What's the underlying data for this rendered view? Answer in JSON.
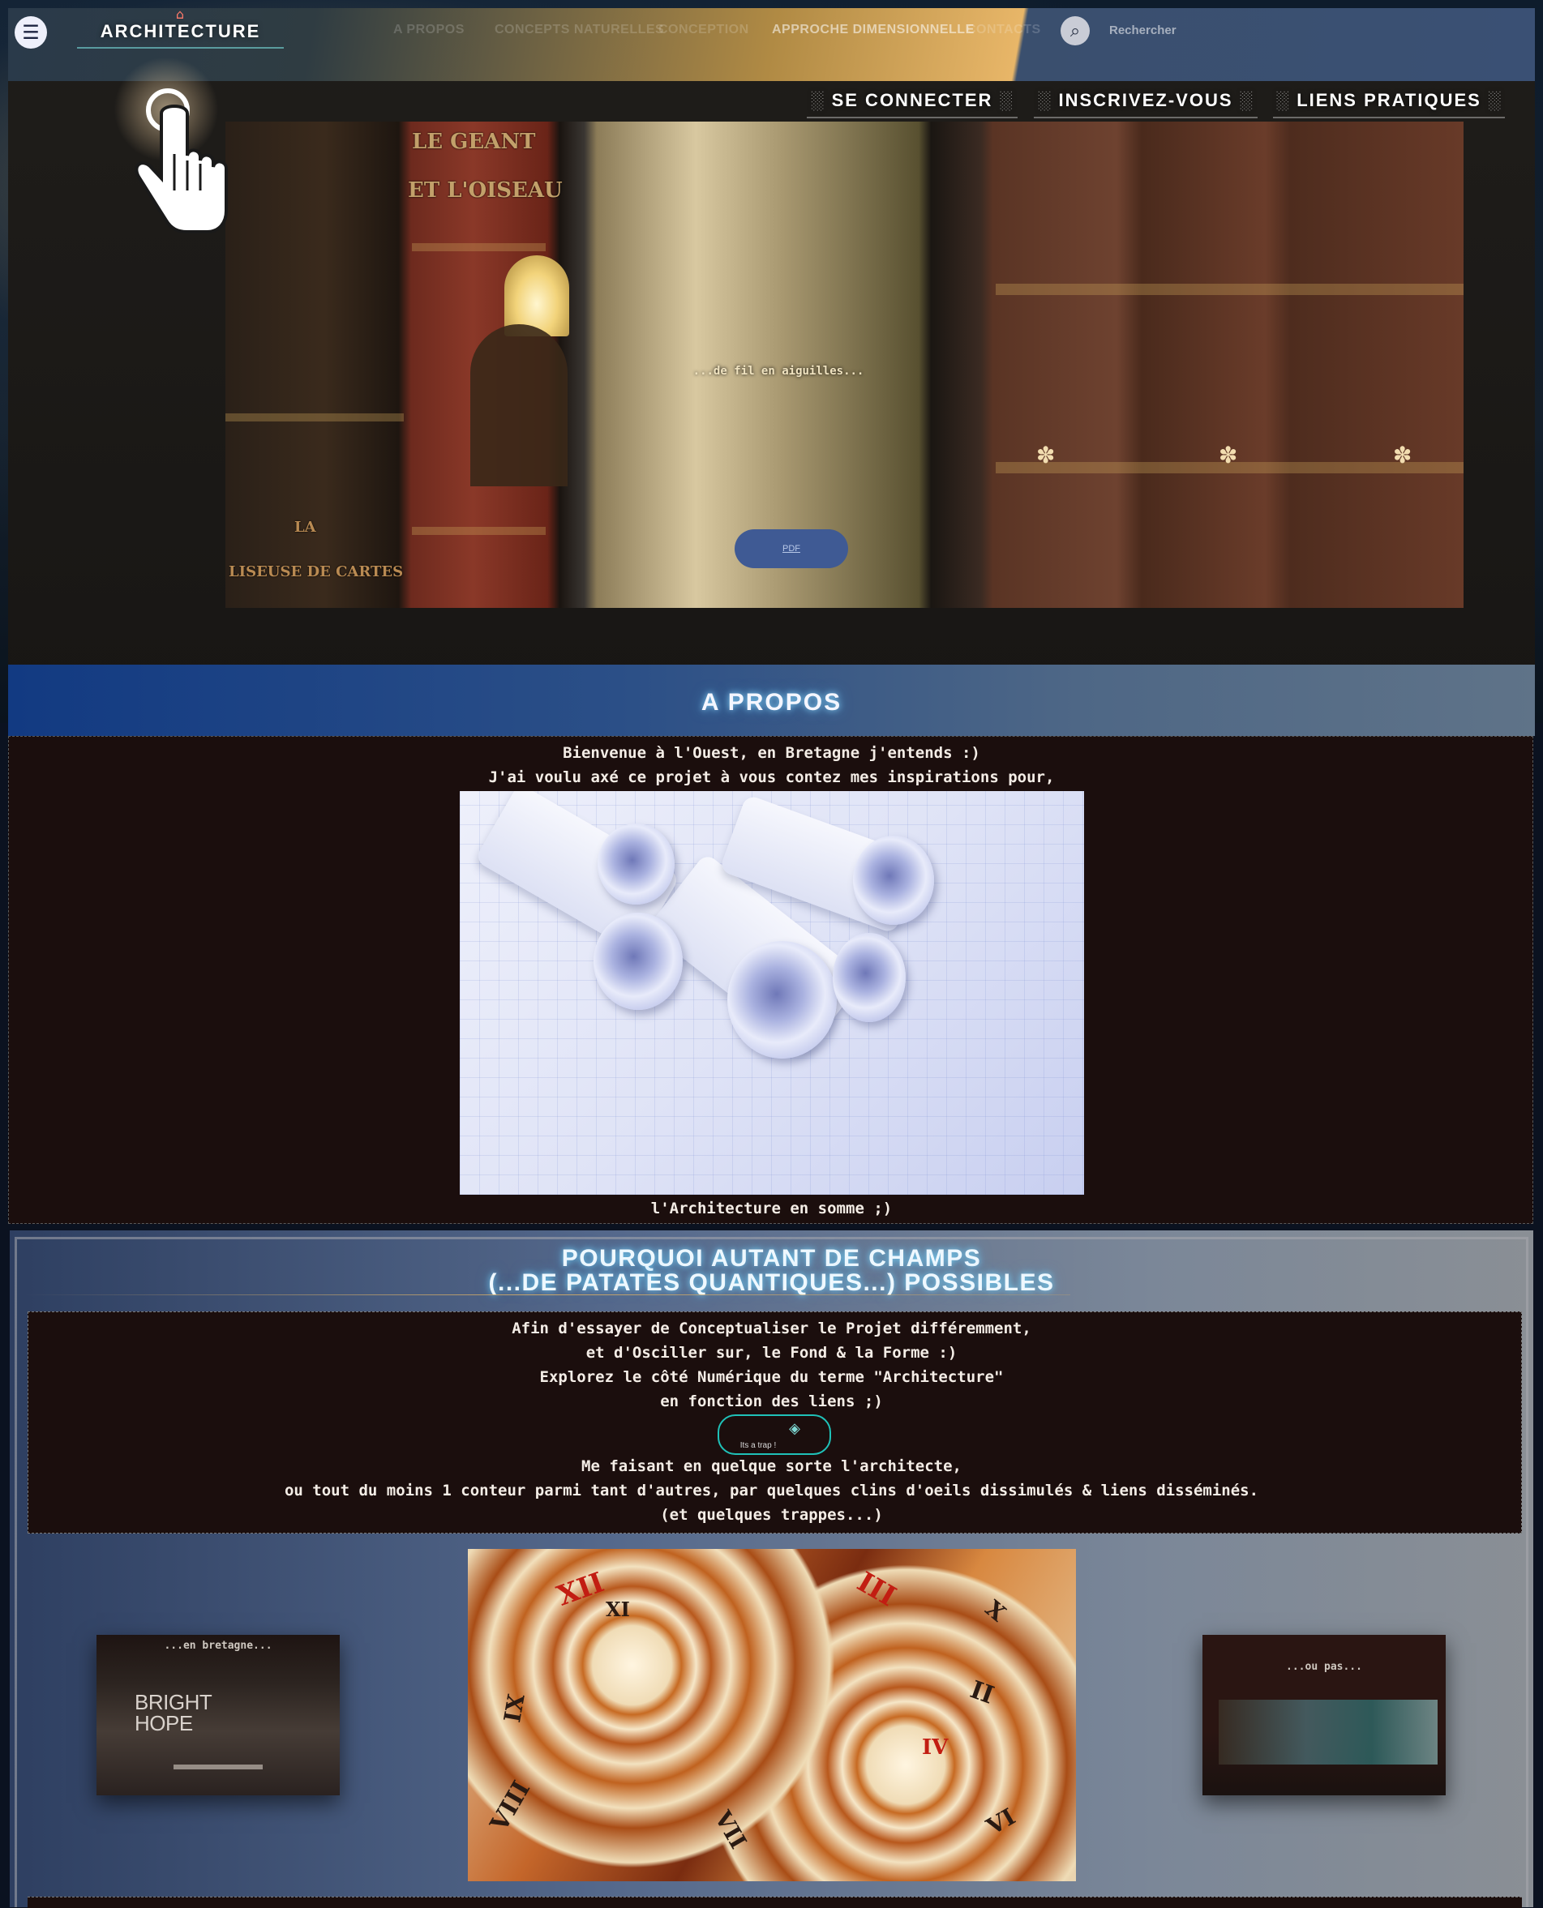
{
  "topbar": {
    "brand": "ARCHITECTURE",
    "nav": [
      "A PROPOS",
      "CONCEPTS NATURELLES",
      "CONCEPTION",
      "APPROCHE DIMENSIONNELLE",
      "CONTACTS"
    ],
    "search_label": "Rechercher"
  },
  "actions": {
    "login": "SE CONNECTER",
    "register": "INSCRIVEZ-VOUS",
    "links": "LIENS PRATIQUES",
    "hatch": "░"
  },
  "hero": {
    "caption": "...de fil en aiguilles...",
    "pdf_label": "PDF",
    "book_titles": [
      "LE GEANT",
      "ET L'OISEAU",
      "LA",
      "LISEUSE DE CARTES"
    ]
  },
  "apropos": {
    "title": "A PROPOS",
    "line1": "Bienvenue à l'Ouest, en Bretagne j'entends :)",
    "line2": "J'ai voulu axé ce projet à vous contez mes inspirations pour,",
    "caption": "l'Architecture en somme ;)"
  },
  "section2": {
    "title_line1": "POURQUOI AUTANT DE CHAMPS",
    "title_line2": "(...DE PATATES QUANTIQUES...) POSSIBLES",
    "lines_top": [
      "Afin d'essayer de Conceptualiser le Projet différemment,",
      "et d'Osciller sur, le Fond & la Forme :)",
      "Explorez le côté Numérique du terme \"Architecture\"",
      "en fonction des liens ;)"
    ],
    "trap_label": "Its a trap !",
    "lines_bottom": [
      "Me faisant en quelque sorte l'architecte,",
      "ou tout du moins 1 conteur parmi tant d'autres, par quelques clins d'oeils dissimulés & liens disséminés.",
      "(et quelques trappes...)"
    ]
  },
  "gallery": {
    "left_caption": "...en bretagne...",
    "left_text": "BRIGHT HOPE",
    "right_caption": "...ou pas...",
    "clock_numerals": [
      "XII",
      "XI",
      "IX",
      "VIII",
      "III",
      "II",
      "IV",
      "VII",
      "X",
      "VI"
    ]
  }
}
